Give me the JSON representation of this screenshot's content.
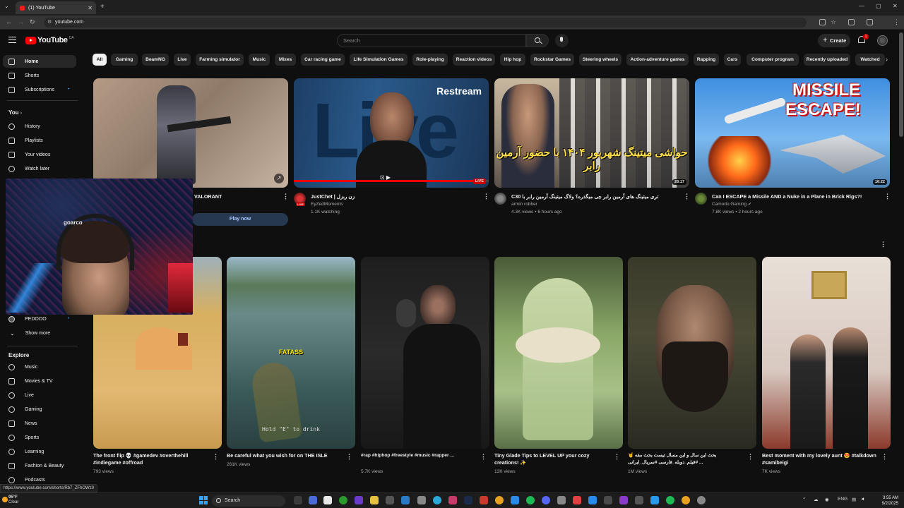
{
  "browser": {
    "tab_title": "(1) YouTube",
    "url": "youtube.com"
  },
  "header": {
    "logo_text": "YouTube",
    "country_code": "CA",
    "search_placeholder": "Search",
    "create_label": "Create",
    "notification_count": "1"
  },
  "sidebar": {
    "main": [
      {
        "label": "Home"
      },
      {
        "label": "Shorts"
      },
      {
        "label": "Subscriptions"
      }
    ],
    "you_heading": "You",
    "you": [
      {
        "label": "History"
      },
      {
        "label": "Playlists"
      },
      {
        "label": "Your videos"
      },
      {
        "label": "Watch later"
      }
    ],
    "subscription_partial": "PEDOOO",
    "show_more": "Show more",
    "explore_heading": "Explore",
    "explore": [
      {
        "label": "Music"
      },
      {
        "label": "Movies & TV"
      },
      {
        "label": "Live"
      },
      {
        "label": "Gaming"
      },
      {
        "label": "News"
      },
      {
        "label": "Sports"
      },
      {
        "label": "Learning"
      },
      {
        "label": "Fashion & Beauty"
      },
      {
        "label": "Podcasts"
      }
    ]
  },
  "chips": [
    "All",
    "Gaming",
    "BeamNG",
    "Live",
    "Farming simulator",
    "Music",
    "Mixes",
    "Car racing game",
    "Life Simulation Games",
    "Role-playing",
    "Reaction videos",
    "Hip hop",
    "Rockstar Games",
    "Steering wheels",
    "Action-adventure games",
    "Rapping",
    "Cars",
    "Computer program",
    "Recently uploaded",
    "Watched"
  ],
  "videos": [
    {
      "title": "VALORANT",
      "action": "Play now"
    },
    {
      "title": "JustChet | زن ربزل",
      "channel": "EyZedMoments",
      "meta": "1.1K watching",
      "live_badge": "LIVE",
      "overlay_text": "Restream",
      "big_text": "Live"
    },
    {
      "title": "C30 تری میتینگ های آرمین رابر چی میگذره؟ ولاگ میتینگ آرمین رابر با",
      "channel": "armin robber",
      "meta": "4.3K views • 6 hours ago",
      "duration": "28:17",
      "overlay_text": "حواشی میتینگ شهریور ۱۴۰۴ با حضور آرمین رابر"
    },
    {
      "title": "Can I ESCAPE a Missile AND a Nuke in a Plane in Brick Rigs?!",
      "channel": "Camodo Gaming",
      "meta": "7.8K views • 2 hours ago",
      "duration": "16:22",
      "overlay_text_1": "MISSILE",
      "overlay_text_2": "ESCAPE!"
    }
  ],
  "shorts": [
    {
      "title": "The front flip 💀 #gamedev #overthehill #indiegame #offroad",
      "views": "793 views"
    },
    {
      "title": "Be careful what you wish for on THE ISLE",
      "views": "261K views",
      "caption": "FATASS",
      "hint": "Hold \"E\" to drink"
    },
    {
      "title": "#rap #hiphop #freestyle #music #rapper ...",
      "views": "5.7K views"
    },
    {
      "title": "Tiny Glade Tips to LEVEL UP your cozy creations! ✨",
      "views": "13K views"
    },
    {
      "title": "بحث این سال و این مسال تیست بحث مقه 🤘 #فیلم_دوبله_فارسی #سریال_ایرانی ...",
      "views": "1M views"
    },
    {
      "title": "Best moment with my lovely aunt 😍 #talkdown #samibeigi",
      "views": "7K views"
    }
  ],
  "webcam_tag": "goarco",
  "status_url": "https://www.youtube.com/shorts/Rb7_ZFhOWz0",
  "taskbar": {
    "temp": "95°F",
    "condition": "Clear",
    "search_label": "Search",
    "lang": "ENG",
    "time": "3:55 AM",
    "date": "9/2/2025"
  }
}
